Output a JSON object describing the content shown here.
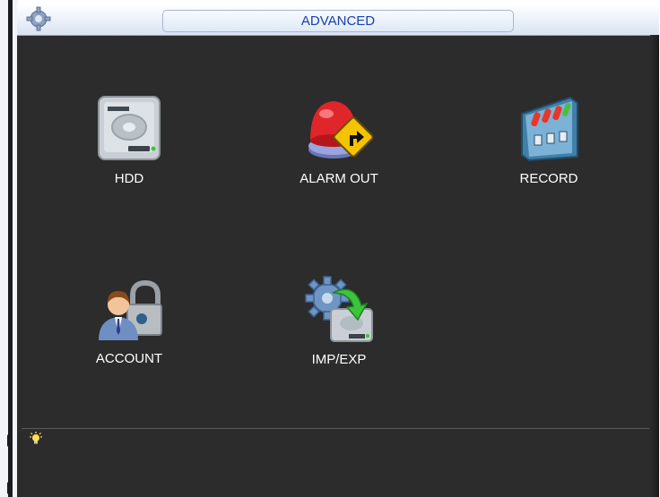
{
  "window": {
    "title": "ADVANCED"
  },
  "tiles": [
    {
      "label": "HDD",
      "icon": "hdd-icon"
    },
    {
      "label": "ALARM OUT",
      "icon": "alarm-out-icon"
    },
    {
      "label": "RECORD",
      "icon": "record-icon"
    },
    {
      "label": "ACCOUNT",
      "icon": "account-icon"
    },
    {
      "label": "IMP/EXP",
      "icon": "imp-exp-icon"
    }
  ],
  "footer": {
    "tip_icon": "lightbulb-icon"
  },
  "colors": {
    "title_text": "#1b3fa8",
    "window_bg": "#2c2c2c",
    "label_text": "#ffffff",
    "alarm_red": "#e0262b",
    "arrow_green": "#3cc43c"
  }
}
